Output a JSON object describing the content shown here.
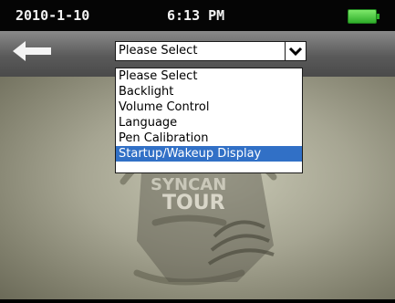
{
  "status": {
    "date": "2010-1-10",
    "time": "6:13 PM",
    "battery": 1.0
  },
  "toolbar": {
    "back_icon": "back-arrow-icon"
  },
  "select": {
    "value": "Please Select",
    "options": [
      "Please Select",
      "Backlight",
      "Volume Control",
      "Language",
      "Pen Calibration",
      "Startup/Wakeup Display"
    ],
    "highlighted_index": 5
  },
  "wallpaper": {
    "logo_text_top": "SYNCAN",
    "logo_text_main": "TOUR"
  },
  "colors": {
    "battery": "#2fae2a",
    "highlight": "#3170c6"
  }
}
